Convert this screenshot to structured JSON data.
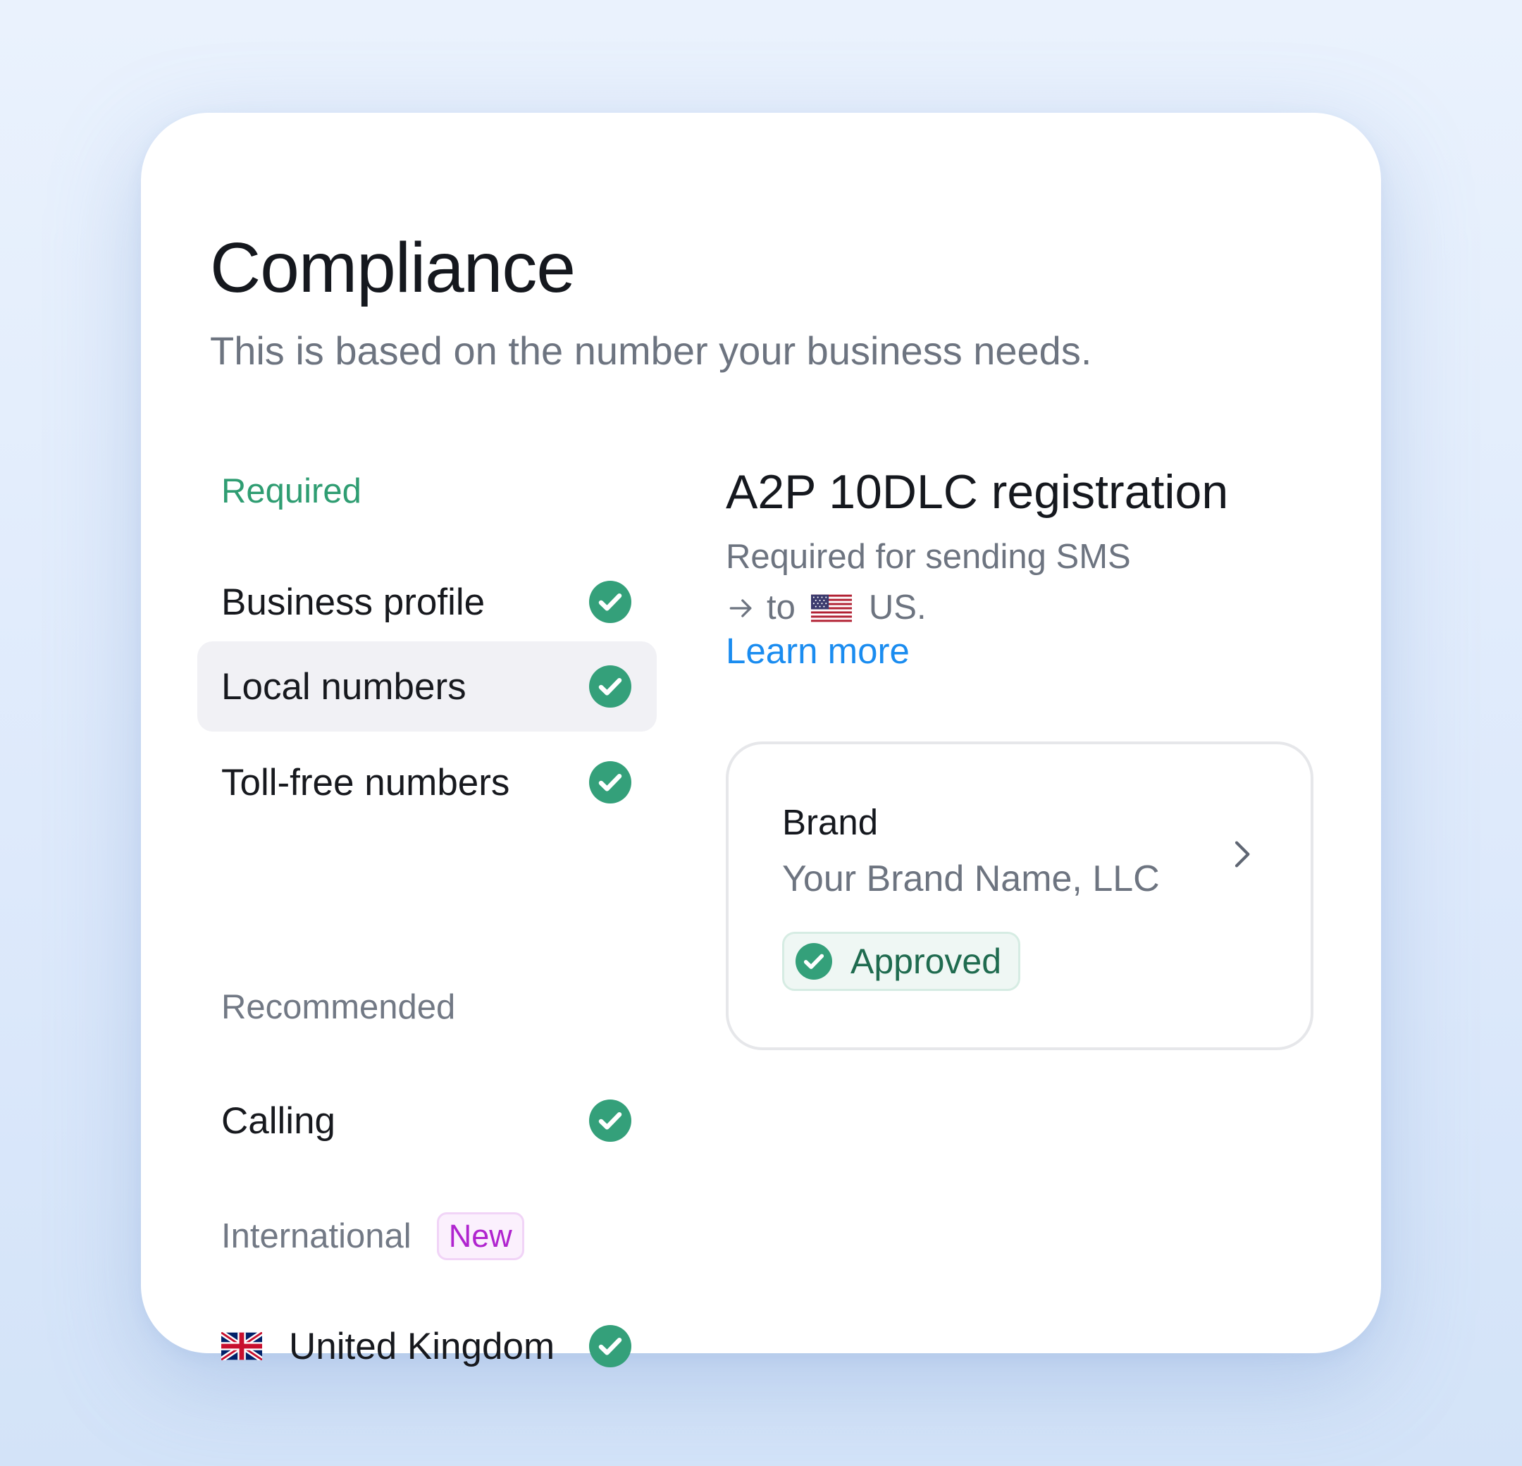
{
  "header": {
    "title": "Compliance",
    "subtitle": "This is based on the number your business needs."
  },
  "sections": {
    "required": {
      "heading": "Required",
      "items": [
        {
          "label": "Business profile",
          "status": "check-circle-icon",
          "active": false
        },
        {
          "label": "Local numbers",
          "status": "check-circle-icon",
          "active": true
        },
        {
          "label": "Toll-free numbers",
          "status": "check-circle-icon",
          "active": false
        }
      ]
    },
    "recommended": {
      "heading": "Recommended",
      "items": [
        {
          "label": "Calling",
          "status": "check-circle-icon",
          "active": false
        }
      ]
    },
    "international": {
      "heading": "International",
      "badge": "New",
      "items": [
        {
          "label": "United Kingdom",
          "flag": "uk-flag-icon",
          "status": "check-circle-icon",
          "active": false
        }
      ]
    }
  },
  "detail": {
    "title": "A2P 10DLC registration",
    "description": "Required for sending SMS",
    "to_text": "to",
    "country": "US.",
    "country_flag": "us-flag-icon",
    "learn_more": "Learn more",
    "brand_card": {
      "label": "Brand",
      "name": "Your Brand Name, LLC",
      "status": "Approved"
    }
  },
  "colors": {
    "accent_green": "#2f9d72",
    "check_green": "#34a07a",
    "link_blue": "#1a8cf0",
    "badge_purple": "#b024cf",
    "muted_text": "#6d7480",
    "active_item_bg": "#f1f1f5",
    "page_background": "#e3edfb"
  }
}
